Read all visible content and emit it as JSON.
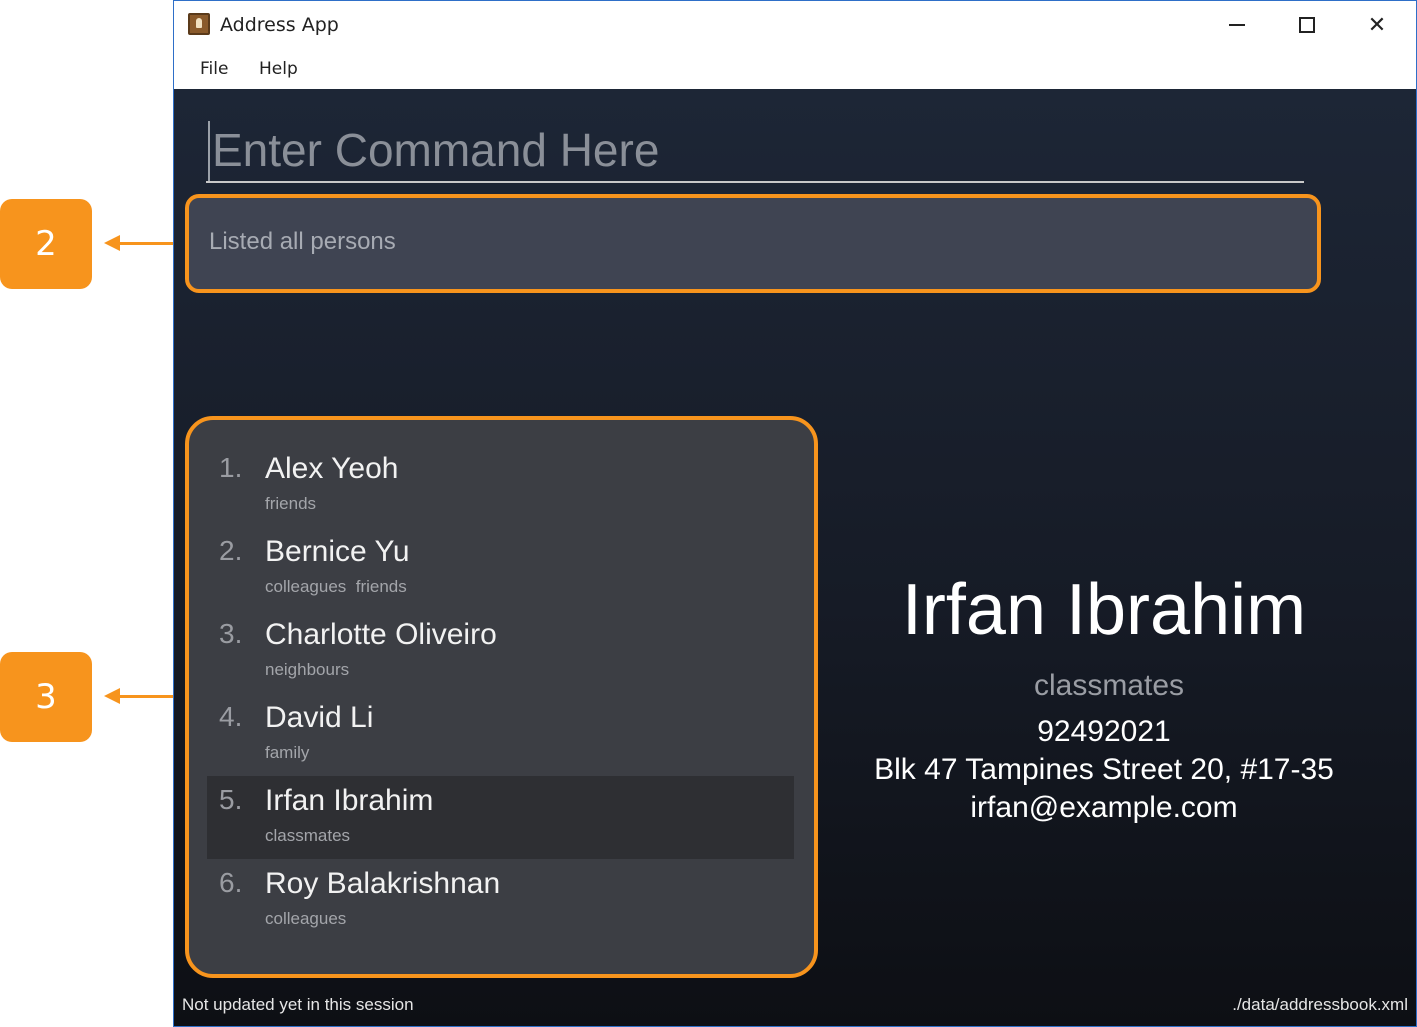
{
  "callouts": [
    {
      "label": "2"
    },
    {
      "label": "3"
    }
  ],
  "window": {
    "title": "Address App",
    "close_glyph": "✕"
  },
  "menu": {
    "file": "File",
    "help": "Help"
  },
  "command": {
    "placeholder": "Enter Command Here",
    "value": ""
  },
  "result": {
    "message": "Listed all persons"
  },
  "persons": [
    {
      "index": "1.",
      "name": "Alex Yeoh",
      "tags": "friends"
    },
    {
      "index": "2.",
      "name": "Bernice Yu",
      "tags": "colleagues  friends"
    },
    {
      "index": "3.",
      "name": "Charlotte Oliveiro",
      "tags": "neighbours"
    },
    {
      "index": "4.",
      "name": "David Li",
      "tags": "family"
    },
    {
      "index": "5.",
      "name": "Irfan Ibrahim",
      "tags": "classmates"
    },
    {
      "index": "6.",
      "name": "Roy Balakrishnan",
      "tags": "colleagues"
    }
  ],
  "selected_person_index": 5,
  "detail": {
    "name": "Irfan Ibrahim",
    "tag": "classmates",
    "phone": "92492021",
    "address": "Blk 47 Tampines Street 20, #17-35",
    "email": "irfan@example.com"
  },
  "status": {
    "sync": "Not updated yet in this session",
    "file": "./data/addressbook.xml"
  },
  "colors": {
    "callout": "#f7941d",
    "background": "#1d2636",
    "panel": "#3c3e44",
    "selected_row": "#2e2f33"
  }
}
